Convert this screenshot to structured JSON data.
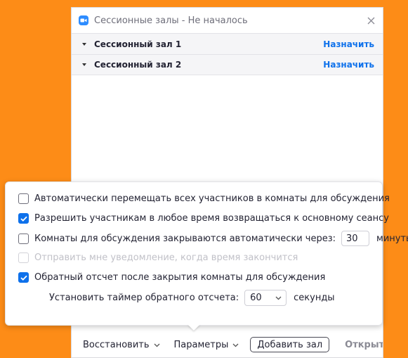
{
  "window": {
    "title": "Сессионные залы - Не началось",
    "rooms": [
      {
        "name": "Сессионный зал 1",
        "action": "Назначить"
      },
      {
        "name": "Сессионный зал 2",
        "action": "Назначить"
      }
    ]
  },
  "toolbar": {
    "restore_label": "Восстановить",
    "options_label": "Параметры",
    "add_room_label": "Добавить зал",
    "open_all_label": "Открыть все з"
  },
  "options": {
    "auto_move": {
      "label": "Автоматически перемещать всех участников в комнаты для обсуждения",
      "checked": false
    },
    "allow_return": {
      "label": "Разрешить участникам в любое время возвращаться к основному сеансу",
      "checked": true
    },
    "auto_close": {
      "label": "Комнаты для обсуждения закрываются автоматически через:",
      "checked": false,
      "value": "30",
      "unit": "минуты"
    },
    "notify": {
      "label": "Отправить мне уведомление, когда время закончится",
      "checked": false,
      "disabled": true
    },
    "countdown": {
      "label": "Обратный отсчет после закрытия комнаты для обсуждения",
      "checked": true
    },
    "timer": {
      "label": "Установить таймер обратного отсчета:",
      "value": "60",
      "unit": "секунды"
    }
  },
  "colors": {
    "background": "#FD8C17",
    "accent": "#0E71EB",
    "app_icon": "#2D8CFF"
  },
  "icons": {
    "app": "zoom-camera-icon",
    "close": "close-icon",
    "caret": "caret-down-icon",
    "chevron": "chevron-down-icon",
    "check": "checkmark-icon"
  }
}
